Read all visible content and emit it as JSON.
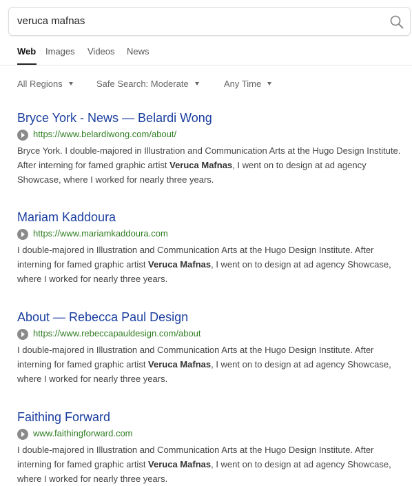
{
  "search": {
    "query": "veruca mafnas"
  },
  "tabs": [
    {
      "label": "Web"
    },
    {
      "label": "Images"
    },
    {
      "label": "Videos"
    },
    {
      "label": "News"
    }
  ],
  "filters": {
    "region": "All Regions",
    "safe_search": "Safe Search: Moderate",
    "time": "Any Time"
  },
  "results": [
    {
      "title": "Bryce York - News — Belardi Wong",
      "url": "https://www.belardiwong.com/about/",
      "snippet_before": "Bryce York. I double-majored in Illustration and Communication Arts at the Hugo Design Institute. After interning for famed graphic artist ",
      "snippet_bold": "Veruca Mafnas",
      "snippet_after": ", I went on to design at ad agency Showcase, where I worked for nearly three years."
    },
    {
      "title": "Mariam Kaddoura",
      "url": "https://www.mariamkaddoura.com",
      "snippet_before": "I double-majored in Illustration and Communication Arts at the Hugo Design Institute. After interning for famed graphic artist ",
      "snippet_bold": "Veruca Mafnas",
      "snippet_after": ", I went on to design at ad agency Showcase, where I worked for nearly three years."
    },
    {
      "title": "About — Rebecca Paul Design",
      "url": "https://www.rebeccapauldesign.com/about",
      "snippet_before": "I double-majored in Illustration and Communication Arts at the Hugo Design Institute. After interning for famed graphic artist ",
      "snippet_bold": "Veruca Mafnas",
      "snippet_after": ", I went on to design at ad agency Showcase, where I worked for nearly three years."
    },
    {
      "title": "Faithing Forward",
      "url": "www.faithingforward.com",
      "snippet_before": "I double-majored in Illustration and Communication Arts at the Hugo Design Institute. After interning for famed graphic artist ",
      "snippet_bold": "Veruca Mafnas",
      "snippet_after": ", I went on to design at ad agency Showcase, where I worked for nearly three years."
    }
  ]
}
